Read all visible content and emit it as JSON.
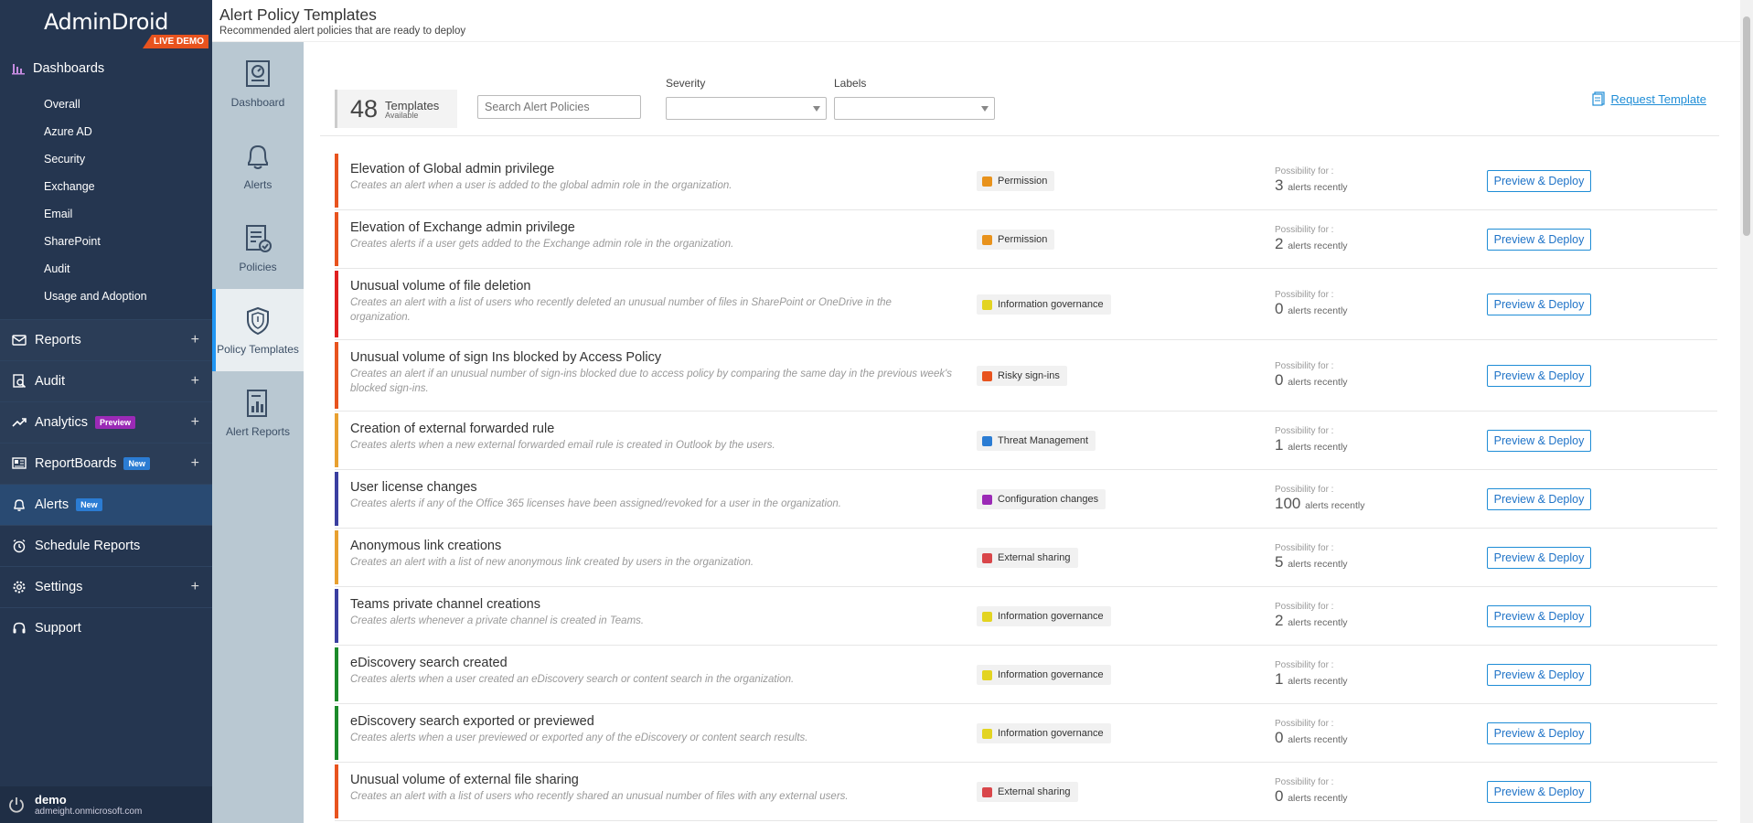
{
  "app": {
    "logo": "AdminDroid",
    "live_badge": "LIVE DEMO"
  },
  "sidebar": {
    "dashboards_label": "Dashboards",
    "dashboard_items": [
      "Overall",
      "Azure AD",
      "Security",
      "Exchange",
      "Email",
      "SharePoint",
      "Audit",
      "Usage and Adoption"
    ],
    "sections": [
      {
        "label": "Reports",
        "icon": "reports-icon",
        "expandable": true
      },
      {
        "label": "Audit",
        "icon": "audit-icon",
        "expandable": true
      },
      {
        "label": "Analytics",
        "icon": "analytics-icon",
        "expandable": true,
        "badge": "Preview"
      },
      {
        "label": "ReportBoards",
        "icon": "reportboards-icon",
        "expandable": true,
        "badge": "New"
      },
      {
        "label": "Alerts",
        "icon": "bell-icon",
        "expandable": false,
        "badge": "New",
        "active": true
      },
      {
        "label": "Schedule Reports",
        "icon": "alarm-clock-icon",
        "expandable": false
      },
      {
        "label": "Settings",
        "icon": "gear-icon",
        "expandable": true
      },
      {
        "label": "Support",
        "icon": "headset-icon",
        "expandable": false
      }
    ],
    "user": {
      "name": "demo",
      "email": "admeight.onmicrosoft.com"
    }
  },
  "sub_nav": [
    {
      "label": "Dashboard",
      "icon": "dashboard-icon"
    },
    {
      "label": "Alerts",
      "icon": "bell-icon"
    },
    {
      "label": "Policies",
      "icon": "policies-icon"
    },
    {
      "label": "Policy Templates",
      "icon": "shield-icon",
      "active": true
    },
    {
      "label": "Alert Reports",
      "icon": "alert-reports-icon"
    }
  ],
  "header": {
    "title": "Alert Policy Templates",
    "subtitle": "Recommended alert policies that are ready to deploy"
  },
  "toolbar": {
    "count": "48",
    "count_label": "Templates",
    "count_sub": "Available",
    "search_placeholder": "Search Alert Policies",
    "severity_label": "Severity",
    "labels_label": "Labels",
    "request_template": "Request Template"
  },
  "possibility_label": "Possibility for :",
  "alerts_recently": "alerts recently",
  "button_label": "Preview & Deploy",
  "templates": [
    {
      "title": "Elevation of Global admin privilege",
      "desc": "Creates an alert when a user is added to the global admin role in the organization.",
      "label": "Permission",
      "label_color": "#e8921c",
      "bar_color": "#e8531e",
      "count": "3"
    },
    {
      "title": "Elevation of Exchange admin privilege",
      "desc": "Creates alerts if a user gets added to the Exchange admin role in the organization.",
      "label": "Permission",
      "label_color": "#e8921c",
      "bar_color": "#e8531e",
      "count": "2"
    },
    {
      "title": "Unusual volume of file deletion",
      "desc": "Creates an alert with a list of users who recently deleted an unusual number of files in SharePoint or OneDrive in the organization.",
      "label": "Information governance",
      "label_color": "#e3d421",
      "bar_color": "#e02020",
      "count": "0"
    },
    {
      "title": "Unusual volume of sign Ins blocked by Access Policy",
      "desc": "Creates an alert if an unusual number of sign-ins blocked due to access policy by comparing the same day in the previous week's blocked sign-ins.",
      "label": "Risky sign-ins",
      "label_color": "#e8531e",
      "bar_color": "#e8531e",
      "count": "0"
    },
    {
      "title": "Creation of external forwarded rule",
      "desc": "Creates alerts when a new external forwarded email rule is created in Outlook by the users.",
      "label": "Threat Management",
      "label_color": "#2b7cd3",
      "bar_color": "#e8a030",
      "count": "1"
    },
    {
      "title": "User license changes",
      "desc": "Creates alerts if any of the Office 365 licenses have been assigned/revoked for a user in the organization.",
      "label": "Configuration changes",
      "label_color": "#9b2ab6",
      "bar_color": "#3a3fa0",
      "count": "100"
    },
    {
      "title": "Anonymous link creations",
      "desc": "Creates an alert with a list of new anonymous link created by users in the organization.",
      "label": "External sharing",
      "label_color": "#d9464a",
      "bar_color": "#e8a030",
      "count": "5"
    },
    {
      "title": "Teams private channel creations",
      "desc": "Creates alerts whenever a private channel is created in Teams.",
      "label": "Information governance",
      "label_color": "#e3d421",
      "bar_color": "#3a3fa0",
      "count": "2"
    },
    {
      "title": "eDiscovery search created",
      "desc": "Creates alerts when a user created an eDiscovery search or content search in the organization.",
      "label": "Information governance",
      "label_color": "#e3d421",
      "bar_color": "#1b8a2a",
      "count": "1"
    },
    {
      "title": "eDiscovery search exported or previewed",
      "desc": "Creates alerts when a user previewed or exported any of the eDiscovery or content search results.",
      "label": "Information governance",
      "label_color": "#e3d421",
      "bar_color": "#1b8a2a",
      "count": "0"
    },
    {
      "title": "Unusual volume of external file sharing",
      "desc": "Creates an alert with a list of users who recently shared an unusual number of files with any external users.",
      "label": "External sharing",
      "label_color": "#d9464a",
      "bar_color": "#e8531e",
      "count": "0"
    }
  ]
}
